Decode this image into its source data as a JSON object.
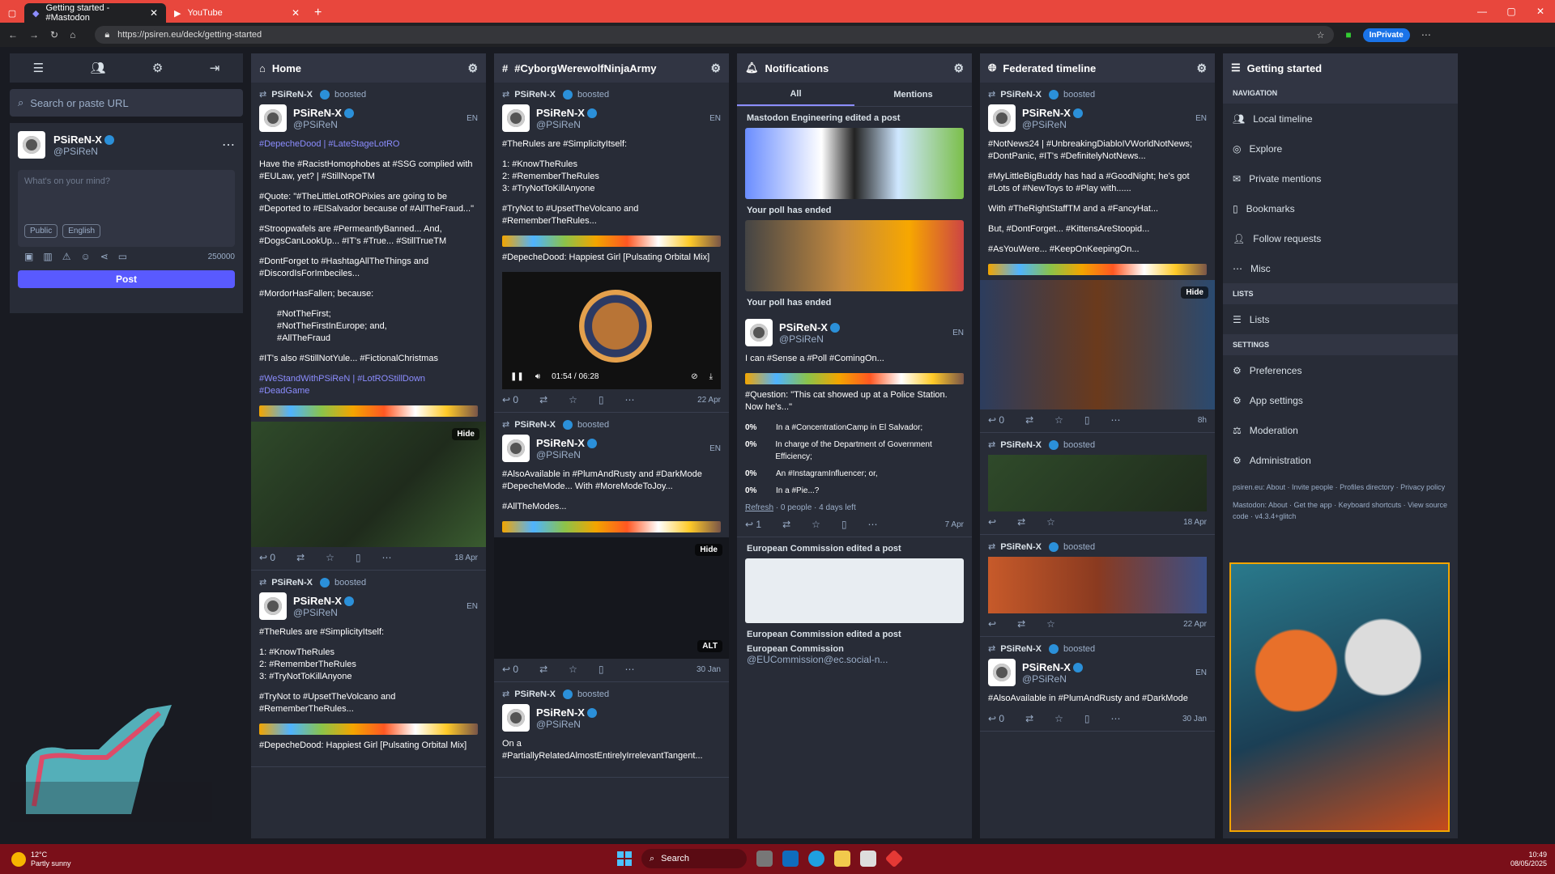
{
  "browser": {
    "tab_active": "Getting started - #Mastodon",
    "tab_inactive": "YouTube",
    "url": "https://psiren.eu/deck/getting-started",
    "inprivate": "InPrivate"
  },
  "drawer": {
    "search_placeholder": "Search or paste URL",
    "user_name": "PSiReN-X",
    "user_handle": "@PSiReN",
    "compose_placeholder": "What's on your mind?",
    "visibility": "Public",
    "language": "English",
    "char_count": "250000",
    "post_label": "Post"
  },
  "columns": {
    "home": {
      "title": "Home",
      "boost_label": "PSiReN-X",
      "boosted": "boosted",
      "name": "PSiReN-X",
      "handle": "@PSiReN",
      "lang": "EN",
      "p1": "#DepecheDood | #LateStageLotRO",
      "p2": "Have the #RacistHomophobes at #SSG complied with #EULaw, yet? | #StillNopeTM",
      "p3": "#Quote: \"#TheLittleLotROPixies are going to be #Deported to #ElSalvador because of #AllTheFraud...\"",
      "p4": "#Stroopwafels are #PermeantlyBanned... And, #DogsCanLookUp... #IT's #True... #StillTrueTM",
      "p5": "#DontForget to #HashtagAllTheThings and #DiscordIsForImbeciles...",
      "p6": "#MordorHasFallen; because:",
      "b1": "#NotTheFirst;",
      "b2": "#NotTheFirstInEurope; and,",
      "b3": "#AllTheFraud",
      "p7": "#IT's also #StillNotYule... #FictionalChristmas",
      "p8": "#WeStandWithPSiReN | #LotROStillDown #DeadGame",
      "hide": "Hide",
      "replies": "0",
      "date": "18 Apr",
      "s2_p1": "#TheRules are #SimplicityItself:",
      "s2_r1": "1: #KnowTheRules",
      "s2_r2": "2: #RememberTheRules",
      "s2_r3": "3: #TryNotToKillAnyone",
      "s2_p2": "#TryNot to #UpsetTheVolcano and #RememberTheRules...",
      "s2_p3": "#DepecheDood: Happiest Girl [Pulsating Orbital Mix]"
    },
    "tag": {
      "title": "#CyborgWerewolfNinjaArmy",
      "p1": "#TheRules are #SimplicityItself:",
      "r1": "1: #KnowTheRules",
      "r2": "2: #RememberTheRules",
      "r3": "3: #TryNotToKillAnyone",
      "p2": "#TryNot to #UpsetTheVolcano and #RememberTheRules...",
      "p3": "#DepecheDood: Happiest Girl [Pulsating Orbital Mix]",
      "time": "01:54 / 06:28",
      "replies": "0",
      "date": "22 Apr",
      "s2_p1": "#AlsoAvailable in #PlumAndRusty and #DarkMode #DepecheMode... With #MoreModeToJoy...",
      "s2_p2": "#AllTheModes...",
      "alt": "ALT",
      "s2_date": "30 Jan",
      "s3_p1": "On a #PartiallyRelatedAlmostEntirelyIrrelevantTangent..."
    },
    "notifications": {
      "title": "Notifications",
      "tab_all": "All",
      "tab_mentions": "Mentions",
      "n1": "Mastodon Engineering edited a post",
      "n2": "Your poll has ended",
      "n3": "Your poll has ended",
      "p1": "I can #Sense a #Poll #ComingOn...",
      "p2": "#Question: \"This cat showed up at a Police Station. Now he's...\"",
      "opt1": "In a #ConcentrationCamp in El Salvador;",
      "opt2": "In charge of the Department of Government Efficiency;",
      "opt3": "An #InstagramInfluencer; or,",
      "opt4": "In a #Pie...?",
      "pct": "0%",
      "refresh": "Refresh",
      "poll_meta": "· 0 people · 4 days left",
      "replies": "1",
      "date": "7 Apr",
      "n4": "European Commission edited a post",
      "n5": "European Commission edited a post",
      "ec_name": "European Commission",
      "ec_handle": "@EUCommission@ec.social-n..."
    },
    "federated": {
      "title": "Federated timeline",
      "p1": "#NotNews24 | #UnbreakingDiabloIVWorldNotNews; #DontPanic, #IT's #DefinitelyNotNews...",
      "p2": "#MyLittleBigBuddy has had a #GoodNight; he's got #Lots of #NewToys to #Play with......",
      "p3": "With #TheRightStaffTM and a #FancyHat...",
      "p4": "But, #DontForget... #KittensAreStoopid...",
      "p5": "#AsYouWere... #KeepOnKeepingOn...",
      "hide": "Hide",
      "replies": "0",
      "age": "8h",
      "d2": "18 Apr",
      "d3": "22 Apr",
      "d4": "30 Jan",
      "s4_p1": "#AlsoAvailable in #PlumAndRusty and #DarkMode"
    },
    "getting_started": {
      "title": "Getting started",
      "nav": "NAVIGATION",
      "items": [
        "Local timeline",
        "Explore",
        "Private mentions",
        "Bookmarks",
        "Follow requests",
        "Misc"
      ],
      "lists_sec": "LISTS",
      "lists": "Lists",
      "settings_sec": "SETTINGS",
      "settings": [
        "Preferences",
        "App settings",
        "Moderation",
        "Administration"
      ],
      "foot1": "psiren.eu: About · Invite people · Profiles directory · Privacy policy",
      "foot2": "Mastodon: About · Get the app · Keyboard shortcuts · View source code · v4.3.4+glitch"
    }
  },
  "taskbar": {
    "temp": "12°C",
    "weather": "Partly sunny",
    "search": "Search",
    "time": "10:49",
    "date": "08/05/2025"
  }
}
